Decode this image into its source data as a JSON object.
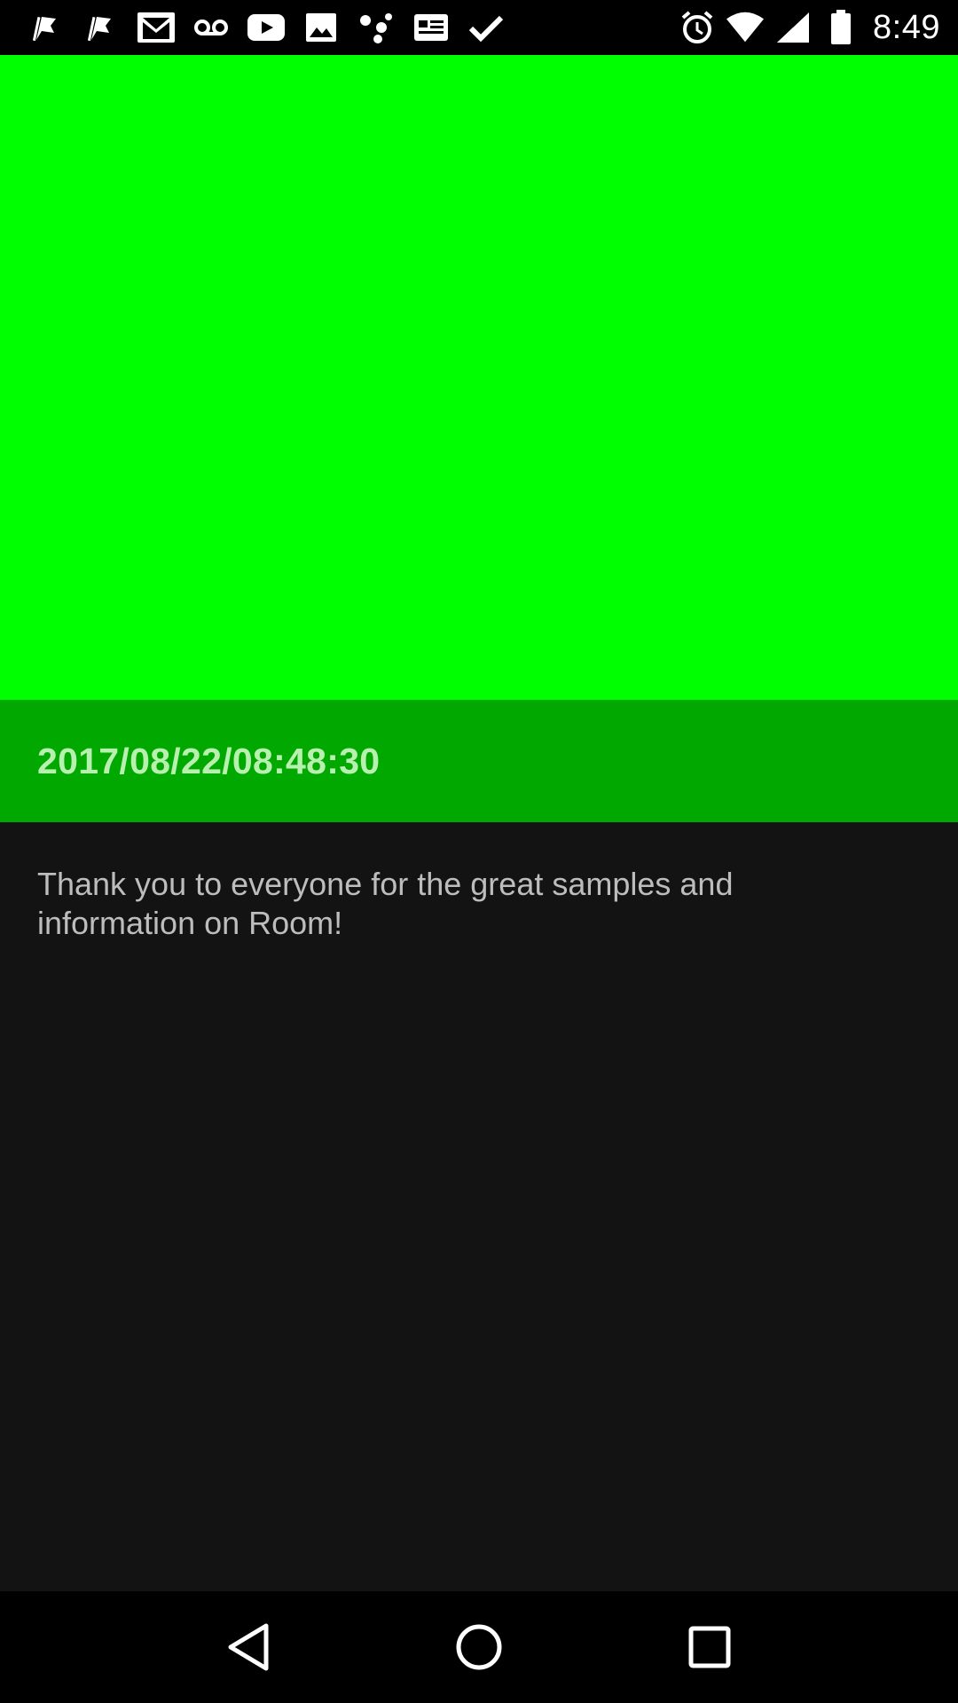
{
  "status_bar": {
    "time": "8:49",
    "left_icons": [
      "flag-icon",
      "flag-icon",
      "gmail-icon",
      "voicemail-icon",
      "youtube-icon",
      "photo-icon",
      "dots-icon",
      "news-icon",
      "check-icon"
    ],
    "right_icons": [
      "alarm-icon",
      "wifi-icon",
      "signal-icon",
      "battery-icon"
    ]
  },
  "hero": {
    "color": "#00ff00"
  },
  "date_banner": {
    "text": "2017/08/22/08:48:30",
    "color": "#00a800"
  },
  "body": {
    "text": "Thank you to everyone for the great samples and information on Room!"
  },
  "nav_bar": {
    "icons": [
      "back-icon",
      "home-icon",
      "recents-icon"
    ]
  }
}
